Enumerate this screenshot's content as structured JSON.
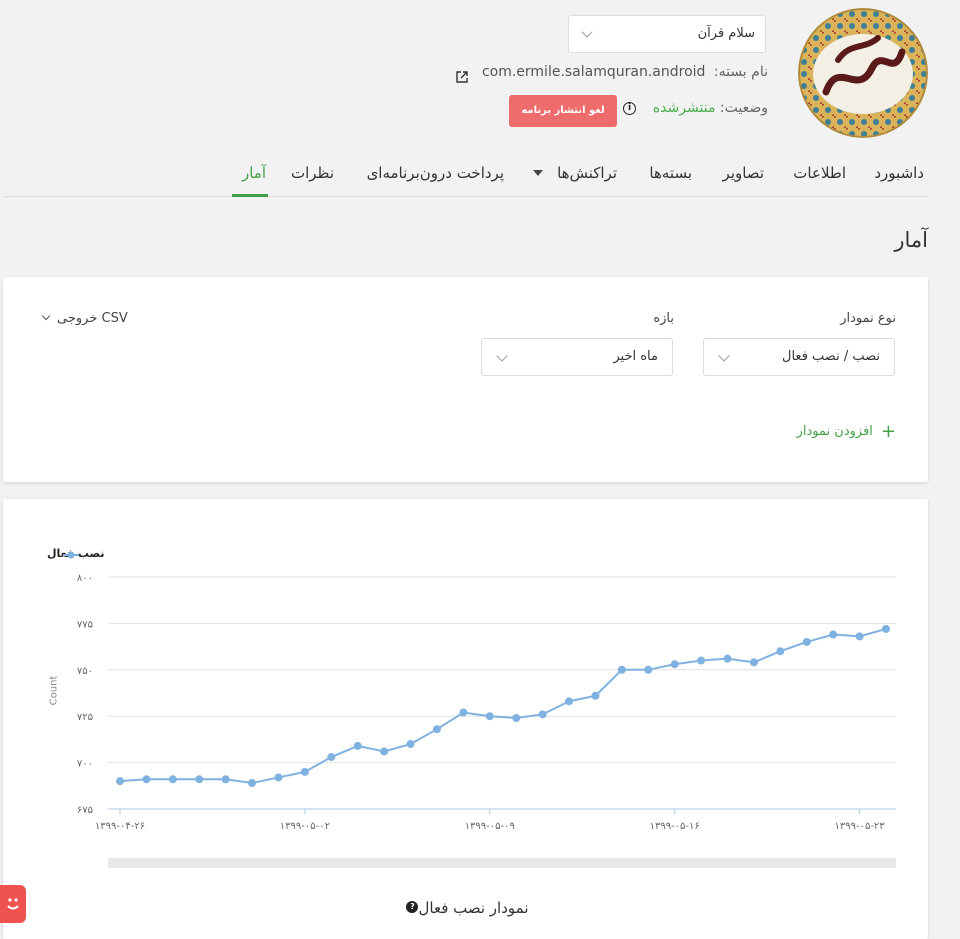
{
  "app": {
    "selected_app": "سلام قرآن",
    "package_label": "نام بسته:",
    "package_name": "com.ermile.salamquran.android",
    "status_label": "وضعیت:",
    "status_value": "منتشرشده",
    "unpublish_button": "لغو انتشار برنامه",
    "logo_icon": "salam-quran-logo",
    "logo_text": "سلام قرآن"
  },
  "tabs": [
    {
      "label": "داشبورد"
    },
    {
      "label": "اطلاعات"
    },
    {
      "label": "تصاویر"
    },
    {
      "label": "بسته‌ها"
    },
    {
      "label": "تراکنش‌ها"
    },
    {
      "label": "پرداخت درون‌برنامه‌ای"
    },
    {
      "label": "نظرات"
    },
    {
      "label": "آمار"
    }
  ],
  "page_title": "آمار",
  "filters": {
    "chart_type_label": "نوع نمودار",
    "chart_type_value": "نصب / نصب فعال",
    "range_label": "بازه",
    "range_value": "ماه اخیر",
    "csv_export": "خروجی CSV",
    "add_chart": "افزودن نمودار"
  },
  "colors": {
    "accent": "#43a047",
    "danger": "#ef6c6c",
    "series": "#7fb2e0"
  },
  "chart_caption": "نمودار نصب فعال",
  "chart_data": {
    "type": "line",
    "ylabel": "Count",
    "ylim": [
      675,
      800
    ],
    "yticks": [
      "۶۷۵",
      "۷۰۰",
      "۷۲۵",
      "۷۵۰",
      "۷۷۵",
      "۸۰۰"
    ],
    "ytick_values": [
      675,
      700,
      725,
      750,
      775,
      800
    ],
    "x_tick_labels": [
      "۱۳۹۹-۰۴-۲۶",
      "۱۳۹۹-۰۵-۰۲",
      "۱۳۹۹-۰۵-۰۹",
      "۱۳۹۹-۰۵-۱۶",
      "۱۳۹۹-۰۵-۲۳"
    ],
    "x_tick_indices": [
      0,
      7,
      14,
      21,
      28
    ],
    "legend_position": "top-left",
    "grid": true,
    "series": [
      {
        "name": "نصب فعال",
        "values": [
          690,
          691,
          691,
          691,
          691,
          689,
          692,
          695,
          703,
          709,
          706,
          710,
          718,
          727,
          725,
          724,
          726,
          733,
          736,
          750,
          750,
          753,
          755,
          756,
          754,
          760,
          765,
          769,
          768,
          772
        ]
      }
    ]
  }
}
